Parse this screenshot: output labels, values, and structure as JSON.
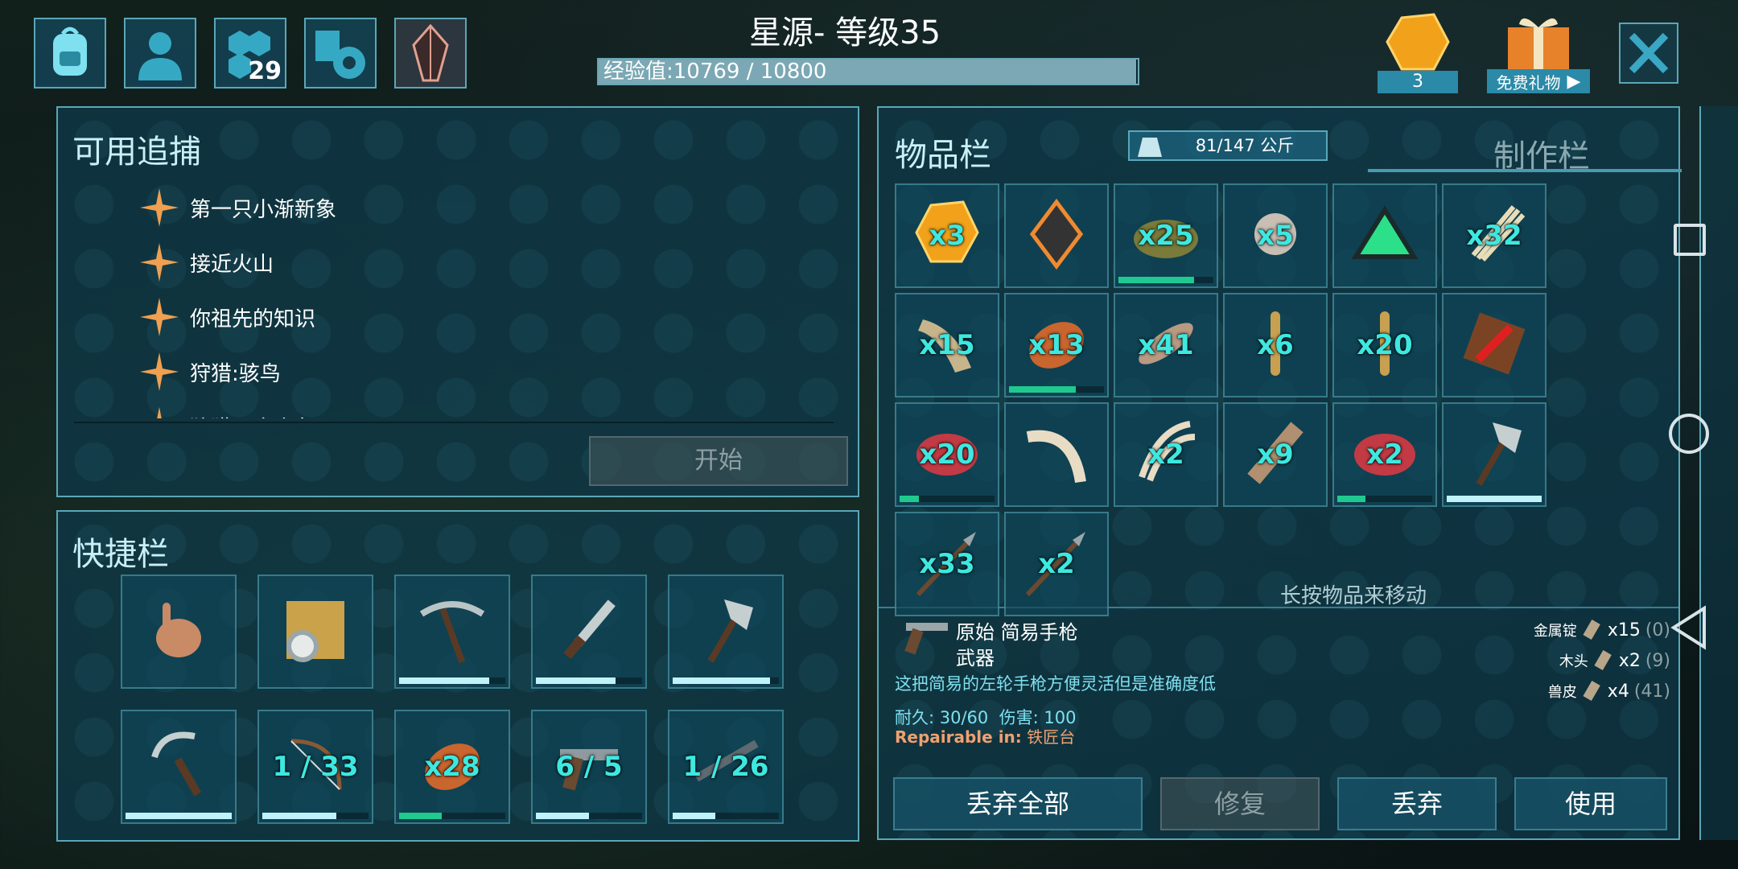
{
  "header": {
    "title": "星源- 等级35",
    "xp_text": "经验值:10769 / 10800",
    "xp_progress": 0.997,
    "engram_badge": "29",
    "element_count": "3",
    "gift_label": "免费礼物"
  },
  "top_icons": [
    "backpack-icon",
    "character-icon",
    "engrams-icon",
    "settings-icon",
    "tek-crystal-icon"
  ],
  "tracking": {
    "title": "可用追捕",
    "items": [
      "第一只小渐新象",
      "接近火山",
      "你祖先的知识",
      "狩猎:骇鸟",
      "狩猎：食人鱼"
    ],
    "start_label": "开始"
  },
  "hotbar": {
    "title": "快捷栏",
    "slots": [
      {
        "icon": "hand-icon",
        "count": "",
        "bar": 0,
        "color": ""
      },
      {
        "icon": "map-compass-icon",
        "count": "",
        "bar": 0,
        "color": ""
      },
      {
        "icon": "pickaxe-icon",
        "count": "",
        "bar": 0.85,
        "color": "#bff3fb"
      },
      {
        "icon": "sword-icon",
        "count": "",
        "bar": 0.75,
        "color": "#bff3fb"
      },
      {
        "icon": "hatchet-icon",
        "count": "",
        "bar": 0.92,
        "color": "#bff3fb"
      },
      {
        "icon": "sickle-icon",
        "count": "",
        "bar": 1.0,
        "color": "#bff3fb"
      },
      {
        "icon": "bow-icon",
        "count": "1 / 33",
        "bar": 0.7,
        "color": "#bff3fb"
      },
      {
        "icon": "cooked-meat-icon",
        "count": "x28",
        "bar": 0.4,
        "color": "#1fc98f"
      },
      {
        "icon": "pistol-icon",
        "count": "6 / 5",
        "bar": 0.5,
        "color": "#bff3fb"
      },
      {
        "icon": "shotgun-icon",
        "count": "1 / 26",
        "bar": 0.4,
        "color": "#bff3fb"
      }
    ]
  },
  "inventory": {
    "tab_title": "物品栏",
    "weight": "81/147 公斤",
    "craft_tab": "制作栏",
    "hint": "长按物品来移动",
    "slots": [
      {
        "icon": "element-icon",
        "count": "x3",
        "bar": 0,
        "color": ""
      },
      {
        "icon": "implant-icon",
        "count": "",
        "bar": 0,
        "color": ""
      },
      {
        "icon": "thatch-bush-icon",
        "count": "x25",
        "bar": 0.8,
        "color": "#1fc98f"
      },
      {
        "icon": "stone-ball-icon",
        "count": "x5",
        "bar": 0,
        "color": ""
      },
      {
        "icon": "tek-triangle-icon",
        "count": "",
        "bar": 0,
        "color": ""
      },
      {
        "icon": "fiber-icon",
        "count": "x32",
        "bar": 0,
        "color": ""
      },
      {
        "icon": "hide-icon",
        "count": "x15",
        "bar": 0,
        "color": ""
      },
      {
        "icon": "cooked-meat-icon",
        "count": "x13",
        "bar": 0.7,
        "color": "#1fc98f"
      },
      {
        "icon": "feather-icon",
        "count": "x41",
        "bar": 0,
        "color": ""
      },
      {
        "icon": "bullet-icon",
        "count": "x6",
        "bar": 0,
        "color": ""
      },
      {
        "icon": "bullet-icon",
        "count": "x20",
        "bar": 0,
        "color": ""
      },
      {
        "icon": "blocked-item-icon",
        "count": "",
        "bar": 0,
        "color": ""
      },
      {
        "icon": "raw-meat-icon",
        "count": "x20",
        "bar": 0.2,
        "color": "#1fc98f"
      },
      {
        "icon": "tusk-icon",
        "count": "",
        "bar": 0,
        "color": ""
      },
      {
        "icon": "claws-icon",
        "count": "x2",
        "bar": 0,
        "color": ""
      },
      {
        "icon": "wood-icon",
        "count": "x9",
        "bar": 0,
        "color": ""
      },
      {
        "icon": "raw-meat-icon",
        "count": "x2",
        "bar": 0.3,
        "color": "#1fc98f"
      },
      {
        "icon": "hatchet-icon",
        "count": "",
        "bar": 1.0,
        "color": "#bff3fb"
      },
      {
        "icon": "spear-icon",
        "count": "x33",
        "bar": 0,
        "color": ""
      },
      {
        "icon": "spear-icon",
        "count": "x2",
        "bar": 0,
        "color": ""
      }
    ]
  },
  "item_detail": {
    "name": "原始 简易手枪",
    "type": "武器",
    "description": "这把简易的左轮手枪方便灵活但是准确度低",
    "stats": "耐久: 30/60  伤害: 100",
    "repair_label": "Repairable in:",
    "repair_station": "铁匠台",
    "cost": [
      {
        "name": "金属锭",
        "amount": "x15",
        "have": "(0)"
      },
      {
        "name": "木头",
        "amount": "x2",
        "have": "(9)"
      },
      {
        "name": "兽皮",
        "amount": "x4",
        "have": "(41)"
      }
    ]
  },
  "actions": {
    "drop_all": "丢弃全部",
    "repair": "修复",
    "drop": "丢弃",
    "use": "使用"
  },
  "colors": {
    "accent": "#5aa7b8",
    "count": "#3de8e0",
    "durability": "#bff3fb",
    "freshness": "#1fc98f",
    "panel": "#0e3848"
  }
}
